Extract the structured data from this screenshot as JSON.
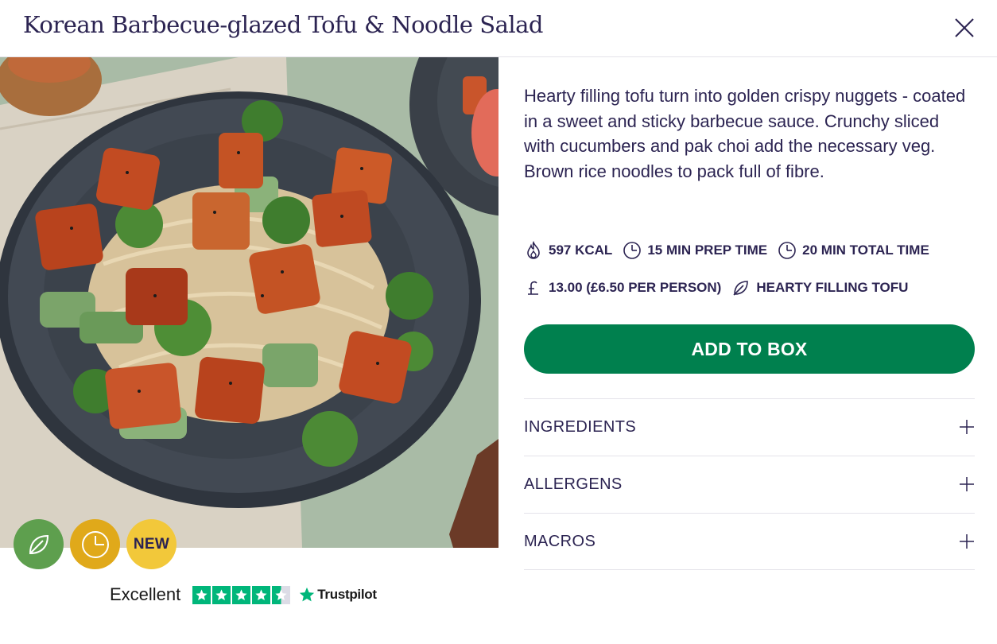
{
  "header": {
    "title": "Korean Barbecue-glazed Tofu & Noodle Salad",
    "close_icon": "close-icon"
  },
  "badges": {
    "vegan_icon": "leaf-icon",
    "quick_icon": "clock-icon",
    "new_label": "NEW"
  },
  "trustpilot": {
    "rating_word": "Excellent",
    "stars": 4.5,
    "brand": "Trustpilot"
  },
  "recipe": {
    "description": "Hearty filling tofu turn into golden crispy nuggets - coated in a sweet and sticky barbecue sauce. Crunchy sliced with cucumbers and pak choi add the necessary veg. Brown rice noodles to pack full of fibre.",
    "calories": "597 KCAL",
    "prep_time": "15 MIN PREP TIME",
    "total_time": "20 MIN TOTAL TIME",
    "price": "13.00 (£6.50 PER PERSON)",
    "protein": "HEARTY FILLING TOFU"
  },
  "actions": {
    "add_to_box": "ADD TO BOX"
  },
  "accordion": [
    {
      "label": "INGREDIENTS"
    },
    {
      "label": "ALLERGENS"
    },
    {
      "label": "MACROS"
    }
  ],
  "colors": {
    "brand_text": "#2c2452",
    "primary_button": "#00804e",
    "vegan_badge": "#5e9f4e",
    "quick_badge": "#e0a91a",
    "new_badge": "#f2c83a",
    "trustpilot_green": "#00b67a"
  }
}
